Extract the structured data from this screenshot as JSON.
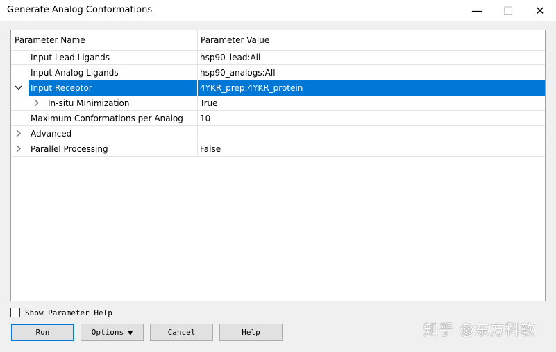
{
  "window": {
    "title": "Generate Analog Conformations",
    "controls": {
      "minimize": "—",
      "maximize": "☐",
      "close": "✕"
    }
  },
  "grid": {
    "headers": {
      "name": "Parameter Name",
      "value": "Parameter Value"
    },
    "rows": [
      {
        "name": "Input Lead Ligands",
        "value": "hsp90_lead:All",
        "expander": "none"
      },
      {
        "name": "Input Analog Ligands",
        "value": "hsp90_analogs:All",
        "expander": "none"
      },
      {
        "name": "Input Receptor",
        "value": "4YKR_prep:4YKR_protein",
        "expander": "expanded",
        "selected": true
      },
      {
        "name": "In-situ Minimization",
        "value": "True",
        "expander": "collapsed"
      },
      {
        "name": "Maximum Conformations per Analog",
        "value": "10",
        "expander": "none"
      },
      {
        "name": "Advanced",
        "value": "",
        "expander": "collapsed"
      },
      {
        "name": "Parallel Processing",
        "value": "False",
        "expander": "collapsed"
      }
    ]
  },
  "show_help": {
    "label": "Show Parameter Help",
    "checked": false
  },
  "buttons": {
    "run": "Run",
    "options": "Options",
    "cancel": "Cancel",
    "help": "Help"
  },
  "watermark": "知乎 @东方科软",
  "colors": {
    "selection": "#0078d7",
    "default_button_border": "#0078d7"
  },
  "icons": {
    "expanded": "chevron-down-icon",
    "collapsed": "chevron-right-icon",
    "dropdown": "triangle-down-icon"
  }
}
